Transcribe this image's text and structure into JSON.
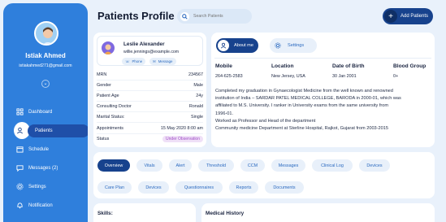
{
  "sidebar": {
    "user_name": "Istiak Ahmed",
    "user_email": "istiakahmed271@gmail.com",
    "items": [
      {
        "label": "Dashboard",
        "icon": "grid-icon",
        "active": false
      },
      {
        "label": "Patients",
        "icon": "patient-icon",
        "active": true
      },
      {
        "label": "Schedule",
        "icon": "calendar-icon",
        "active": false
      },
      {
        "label": "Messages (2)",
        "icon": "message-icon",
        "active": false
      },
      {
        "label": "Settings",
        "icon": "gear-icon",
        "active": false
      },
      {
        "label": "Notification",
        "icon": "bell-icon",
        "active": false
      }
    ]
  },
  "header": {
    "title": "Patients Profile",
    "search_placeholder": "Search Patients",
    "add_label": "Add Patients"
  },
  "patient": {
    "name": "Leslie Alexander",
    "email": "willie.jennings@example.com",
    "phone_label": "Phone",
    "message_label": "Message",
    "rows": [
      {
        "label": "MRN",
        "value": "234567"
      },
      {
        "label": "Gender",
        "value": "Male"
      },
      {
        "label": "Patient Age",
        "value": "24y"
      },
      {
        "label": "Consulting Doctor",
        "value": "Ronald"
      },
      {
        "label": "Marital Status:",
        "value": "Single"
      },
      {
        "label": "Appointments",
        "value": "15 May 2020 8:00 am"
      },
      {
        "label": "Status",
        "value": "Under Observation"
      }
    ]
  },
  "info": {
    "tab_about": "About me",
    "tab_settings": "Settings",
    "headers": [
      "Mobile",
      "Location",
      "Date of Birth",
      "Blood Group"
    ],
    "values": [
      "264-625-2583",
      "New Jersey, USA",
      "30 Jan 2001",
      "0+"
    ],
    "bio": [
      "Completed my graduation in Gynaecologist Medicine from the well known and renowned",
      "institution of India – SARDAR PATEL MEDICAL COLLEGE, BARODA in 2000-01, which was",
      "affiliated to M.S. University. I ranker in University exams from the same university from",
      "1996-01.",
      "Worked as Professor and Head of the department",
      "Community medicine Department at Sterline Hospital, Rajkot, Gujarat from 2003-2015"
    ]
  },
  "tabs": {
    "row1": [
      "Overview",
      "Vitals",
      "Alert",
      "Threshold",
      "CCM",
      "Messages",
      "Clinical Log",
      "Devices"
    ],
    "row2": [
      "Care Plan",
      "Devices",
      "Questionnaires",
      "Reports",
      "Documents"
    ]
  },
  "sections": {
    "skills": "Skills:",
    "medical_history": "Medical History"
  },
  "colors": {
    "sidebar": "#2f7fdc",
    "primary": "#17428d",
    "status_badge": "#a14dc7"
  }
}
